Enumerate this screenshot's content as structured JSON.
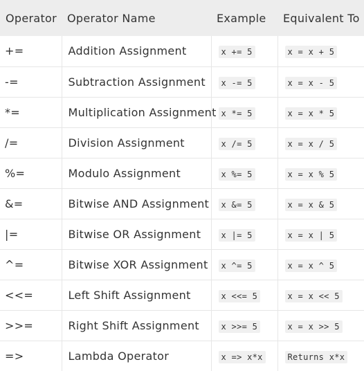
{
  "table": {
    "headers": [
      "Operator",
      "Operator Name",
      "Example",
      "Equivalent To"
    ],
    "rows": [
      {
        "operator": "+=",
        "name": "Addition Assignment",
        "example": "x += 5",
        "equivalent": "x = x + 5"
      },
      {
        "operator": "-=",
        "name": "Subtraction Assignment",
        "example": "x -= 5",
        "equivalent": "x = x - 5"
      },
      {
        "operator": "*=",
        "name": "Multiplication Assignment",
        "example": "x *= 5",
        "equivalent": "x = x * 5"
      },
      {
        "operator": "/=",
        "name": "Division Assignment",
        "example": "x /= 5",
        "equivalent": "x = x / 5"
      },
      {
        "operator": "%=",
        "name": "Modulo Assignment",
        "example": "x %= 5",
        "equivalent": "x = x % 5"
      },
      {
        "operator": "&=",
        "name": "Bitwise AND Assignment",
        "example": "x &= 5",
        "equivalent": "x = x & 5"
      },
      {
        "operator": "|=",
        "name": "Bitwise OR Assignment",
        "example": "x |= 5",
        "equivalent": "x = x | 5"
      },
      {
        "operator": "^=",
        "name": "Bitwise XOR Assignment",
        "example": "x ^= 5",
        "equivalent": "x = x ^ 5"
      },
      {
        "operator": "<<=",
        "name": "Left Shift Assignment",
        "example": "x <<= 5",
        "equivalent": "x = x << 5"
      },
      {
        "operator": ">>=",
        "name": "Right Shift Assignment",
        "example": "x >>= 5",
        "equivalent": "x = x >> 5"
      },
      {
        "operator": "=>",
        "name": "Lambda Operator",
        "example": "x => x*x",
        "equivalent": "Returns x*x"
      }
    ]
  }
}
